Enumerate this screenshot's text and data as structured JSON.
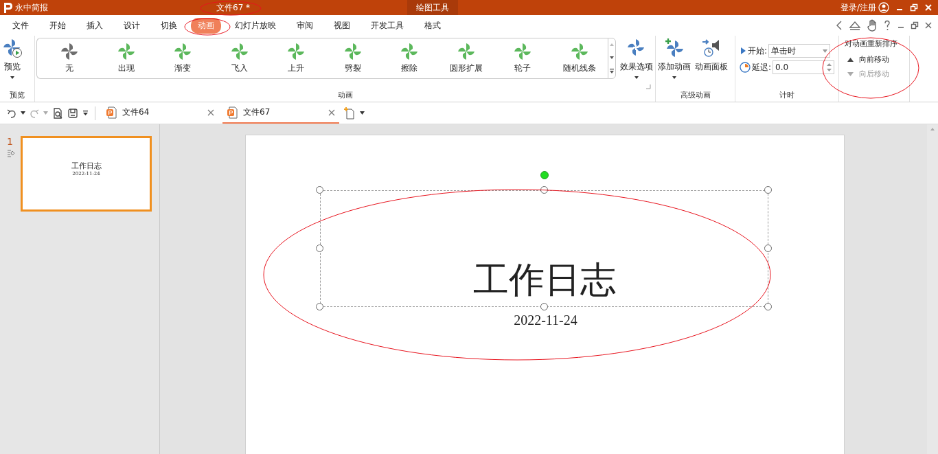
{
  "title_bar": {
    "app_name": "永中简报",
    "document_title": "文件67 *",
    "context_tab": "绘图工具",
    "login": "登录/注册"
  },
  "menu_tabs": [
    {
      "label": "文件",
      "selected": false
    },
    {
      "label": "开始",
      "selected": false
    },
    {
      "label": "插入",
      "selected": false
    },
    {
      "label": "设计",
      "selected": false
    },
    {
      "label": "切换",
      "selected": false
    },
    {
      "label": "动画",
      "selected": true
    },
    {
      "label": "幻灯片放映",
      "selected": false
    },
    {
      "label": "审阅",
      "selected": false
    },
    {
      "label": "视图",
      "selected": false
    },
    {
      "label": "开发工具",
      "selected": false
    },
    {
      "label": "格式",
      "selected": false
    }
  ],
  "ribbon": {
    "preview": {
      "label": "预览",
      "group": "预览"
    },
    "animations": {
      "group": "动画",
      "items": [
        {
          "label": "无",
          "color": "#6e6e6e"
        },
        {
          "label": "出现",
          "color": "#5cb85c"
        },
        {
          "label": "渐变",
          "color": "#5cb85c"
        },
        {
          "label": "飞入",
          "color": "#5cb85c"
        },
        {
          "label": "上升",
          "color": "#5cb85c"
        },
        {
          "label": "劈裂",
          "color": "#5cb85c"
        },
        {
          "label": "擦除",
          "color": "#5cb85c"
        },
        {
          "label": "圆形扩展",
          "color": "#5cb85c"
        },
        {
          "label": "轮子",
          "color": "#5cb85c"
        },
        {
          "label": "随机线条",
          "color": "#5cb85c"
        }
      ]
    },
    "effect_options": "效果选项",
    "add_animation": "添加动画",
    "animation_pane": "动画面板",
    "advanced_group": "高级动画",
    "timing": {
      "start_label": "开始:",
      "start_value": "单击时",
      "delay_label": "延迟:",
      "delay_value": "0.0",
      "group": "计时"
    },
    "reorder": {
      "title": "对动画重新排序",
      "move_earlier": {
        "label": "向前移动",
        "disabled": false
      },
      "move_later": {
        "label": "向后移动",
        "disabled": true
      }
    }
  },
  "doc_tabs": [
    {
      "label": "文件64",
      "selected": false
    },
    {
      "label": "文件67",
      "selected": true
    }
  ],
  "slide_panel": {
    "slides": [
      {
        "number": "1",
        "selected": true,
        "title": "工作日志",
        "date": "2022-11-24"
      }
    ]
  },
  "slide": {
    "title": "工作日志",
    "date": "2022-11-24"
  }
}
